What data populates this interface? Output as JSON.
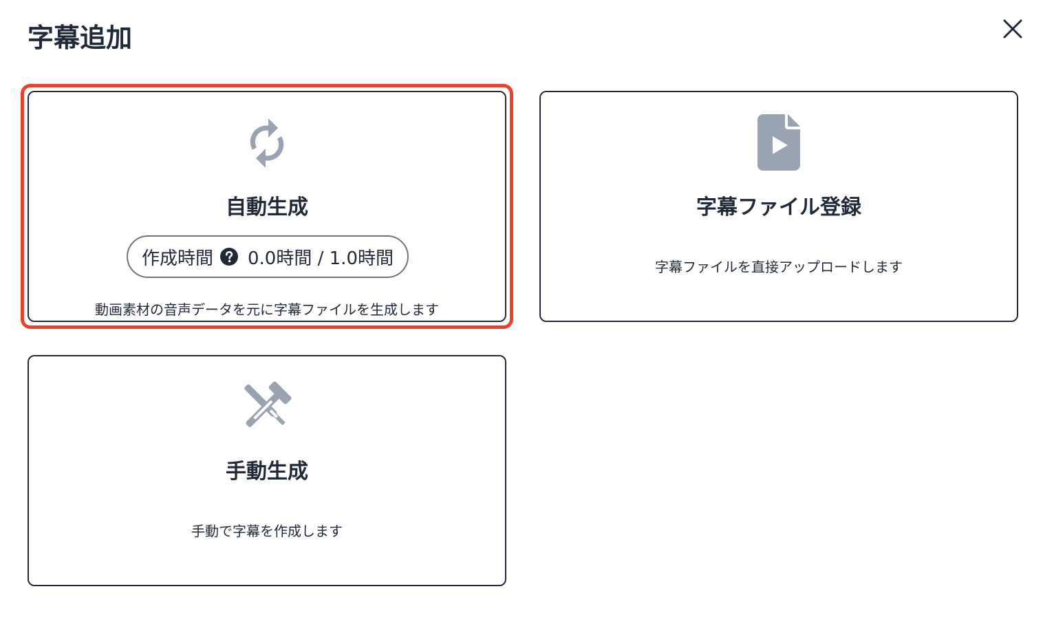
{
  "dialog": {
    "title": "字幕追加"
  },
  "cards": {
    "auto": {
      "title": "自動生成",
      "time_label": "作成時間",
      "time_value": "0.0時間 / 1.0時間",
      "description": "動画素材の音声データを元に字幕ファイルを生成します"
    },
    "file": {
      "title": "字幕ファイル登録",
      "description": "字幕ファイルを直接アップロードします"
    },
    "manual": {
      "title": "手動生成",
      "description": "手動で字幕を作成します"
    }
  },
  "icons": {
    "close": "close-icon",
    "auto": "refresh-icon",
    "file": "video-file-icon",
    "manual": "tools-icon",
    "help": "question-circle-icon"
  },
  "colors": {
    "highlight": "#e8412b",
    "icon": "#9aa3b2",
    "text": "#1f2937"
  }
}
